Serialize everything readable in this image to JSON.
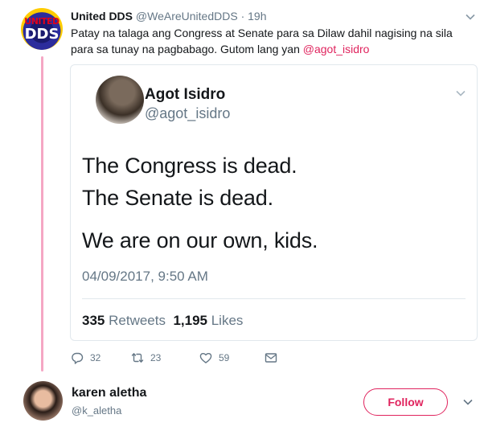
{
  "tweet": {
    "author_name": "United DDS",
    "author_handle": "@WeAreUnitedDDS",
    "separator": "·",
    "time": "19h",
    "text": "Patay na talaga ang Congress at Senate para sa Dilaw dahil nagising na sila para sa tunay na pagbabago. Gutom lang yan ",
    "mention": "@agot_isidro",
    "avatar_text_top": "UNITED",
    "avatar_text_bottom": "DDS",
    "actions": {
      "reply_count": "32",
      "retweet_count": "23",
      "like_count": "59"
    }
  },
  "quoted_tweet": {
    "author_name": "Agot Isidro",
    "author_handle": "@agot_isidro",
    "lines": [
      "The Congress is dead.",
      "The Senate is dead.",
      "We are on our own, kids."
    ],
    "timestamp": "04/09/2017, 9:50 AM",
    "retweets_count": "335",
    "retweets_label": "Retweets",
    "likes_count": "1,195",
    "likes_label": "Likes"
  },
  "follow_suggestion": {
    "name": "karen aletha",
    "handle": "@k_aletha",
    "follow_label": "Follow"
  },
  "colors": {
    "accent": "#e0245e",
    "thread_line": "#f5a7c4",
    "muted_text": "#657786",
    "border": "#e1e8ed"
  },
  "icons": {
    "reply": "reply-icon",
    "retweet": "retweet-icon",
    "like": "heart-icon",
    "message": "message-icon",
    "menu": "chevron-down-icon"
  }
}
